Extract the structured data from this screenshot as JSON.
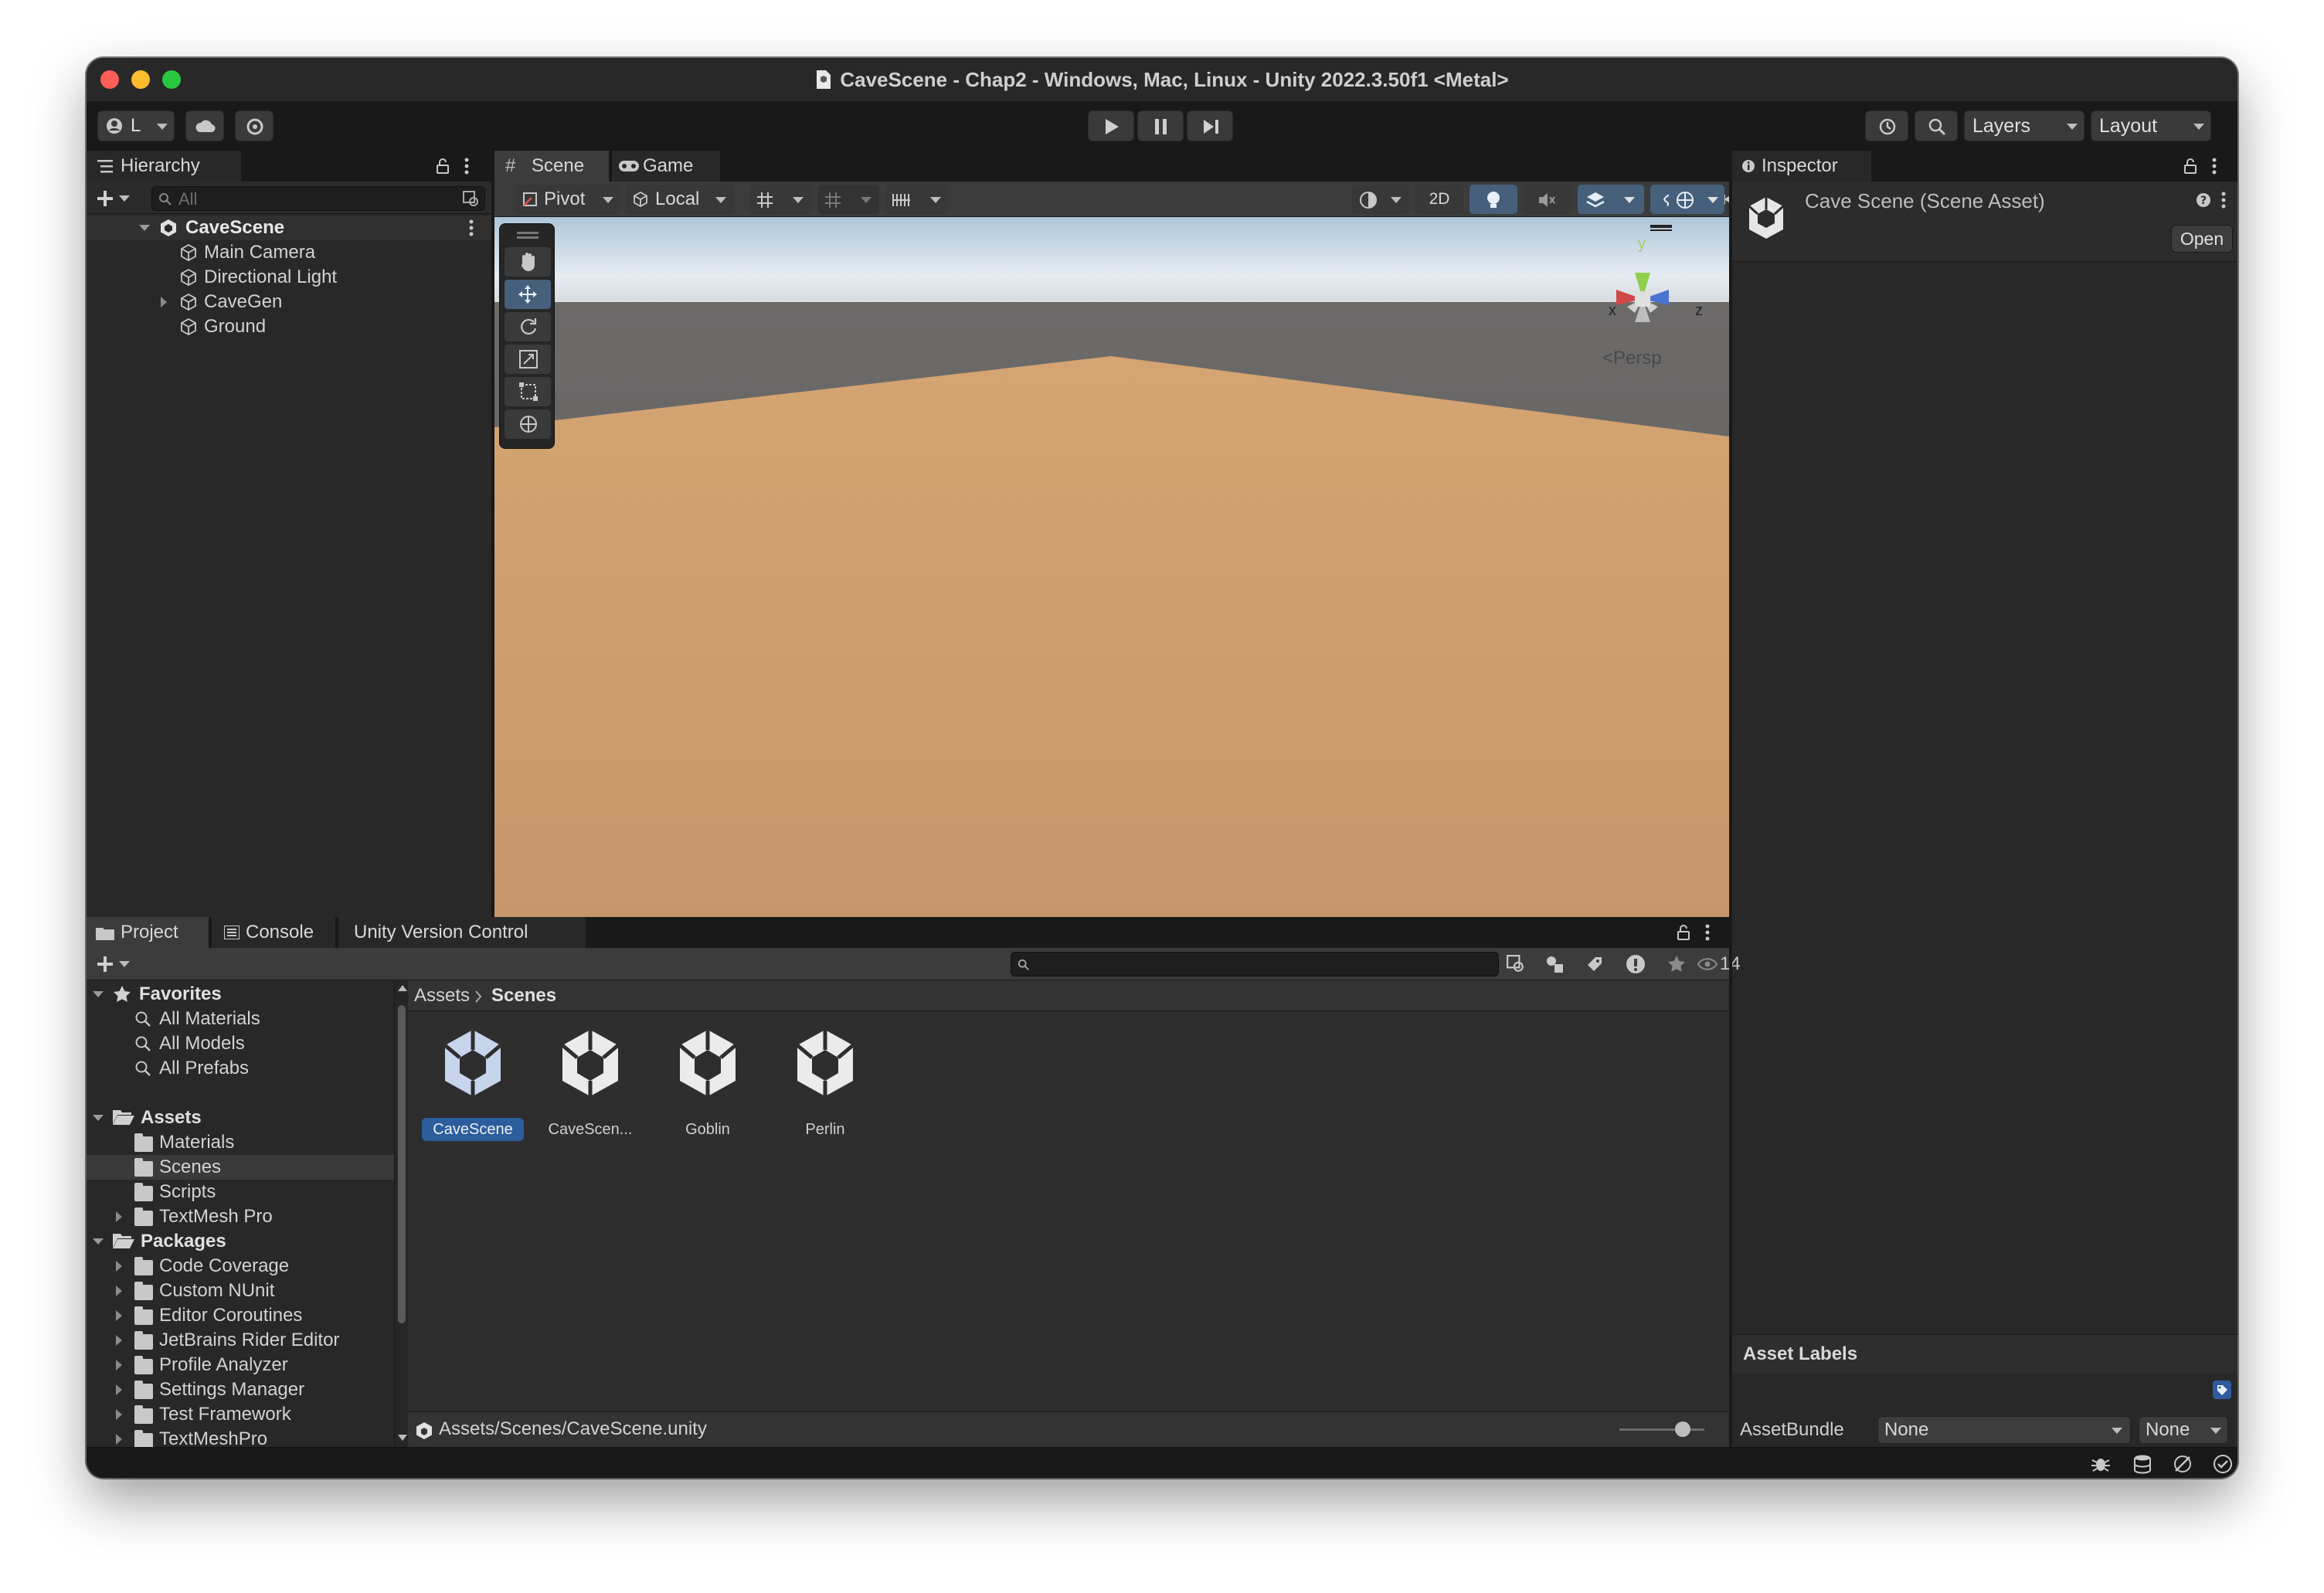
{
  "window": {
    "title": "CaveScene - Chap2 - Windows, Mac, Linux - Unity 2022.3.50f1 <Metal>"
  },
  "toolbar": {
    "account_label": "L",
    "layers_label": "Layers",
    "layout_label": "Layout"
  },
  "hierarchy": {
    "tab_label": "Hierarchy",
    "search_placeholder": "All",
    "scene_name": "CaveScene",
    "items": [
      "Main Camera",
      "Directional Light",
      "CaveGen",
      "Ground"
    ]
  },
  "scene_view": {
    "tabs": [
      "Scene",
      "Game"
    ],
    "pivot_label": "Pivot",
    "local_label": "Local",
    "mode_2d_label": "2D",
    "gizmo_y": "y",
    "gizmo_x": "x",
    "gizmo_z": "z",
    "persp_label": "Persp"
  },
  "inspector": {
    "tab_label": "Inspector",
    "asset_title": "Cave Scene (Scene Asset)",
    "open_button": "Open",
    "asset_labels": "Asset Labels",
    "assetbundle_label": "AssetBundle",
    "assetbundle_value": "None",
    "variant_value": "None"
  },
  "project": {
    "tabs": [
      "Project",
      "Console",
      "Unity Version Control"
    ],
    "hidden_count": "14",
    "favorites": {
      "label": "Favorites",
      "items": [
        "All Materials",
        "All Models",
        "All Prefabs"
      ]
    },
    "assets": {
      "label": "Assets",
      "items": [
        "Materials",
        "Scenes",
        "Scripts",
        "TextMesh Pro"
      ]
    },
    "packages": {
      "label": "Packages",
      "items": [
        "Code Coverage",
        "Custom NUnit",
        "Editor Coroutines",
        "JetBrains Rider Editor",
        "Profile Analyzer",
        "Settings Manager",
        "Test Framework",
        "TextMeshPro"
      ]
    },
    "breadcrumb": [
      "Assets",
      "Scenes"
    ],
    "files": [
      "CaveScene",
      "CaveScen...",
      "Goblin",
      "Perlin"
    ],
    "status_path": "Assets/Scenes/CaveScene.unity"
  },
  "colors": {
    "accent": "#3a79bb",
    "ground": "#c8996a",
    "sky_top": "#a8c0d4",
    "panel": "#2b2b2b"
  }
}
